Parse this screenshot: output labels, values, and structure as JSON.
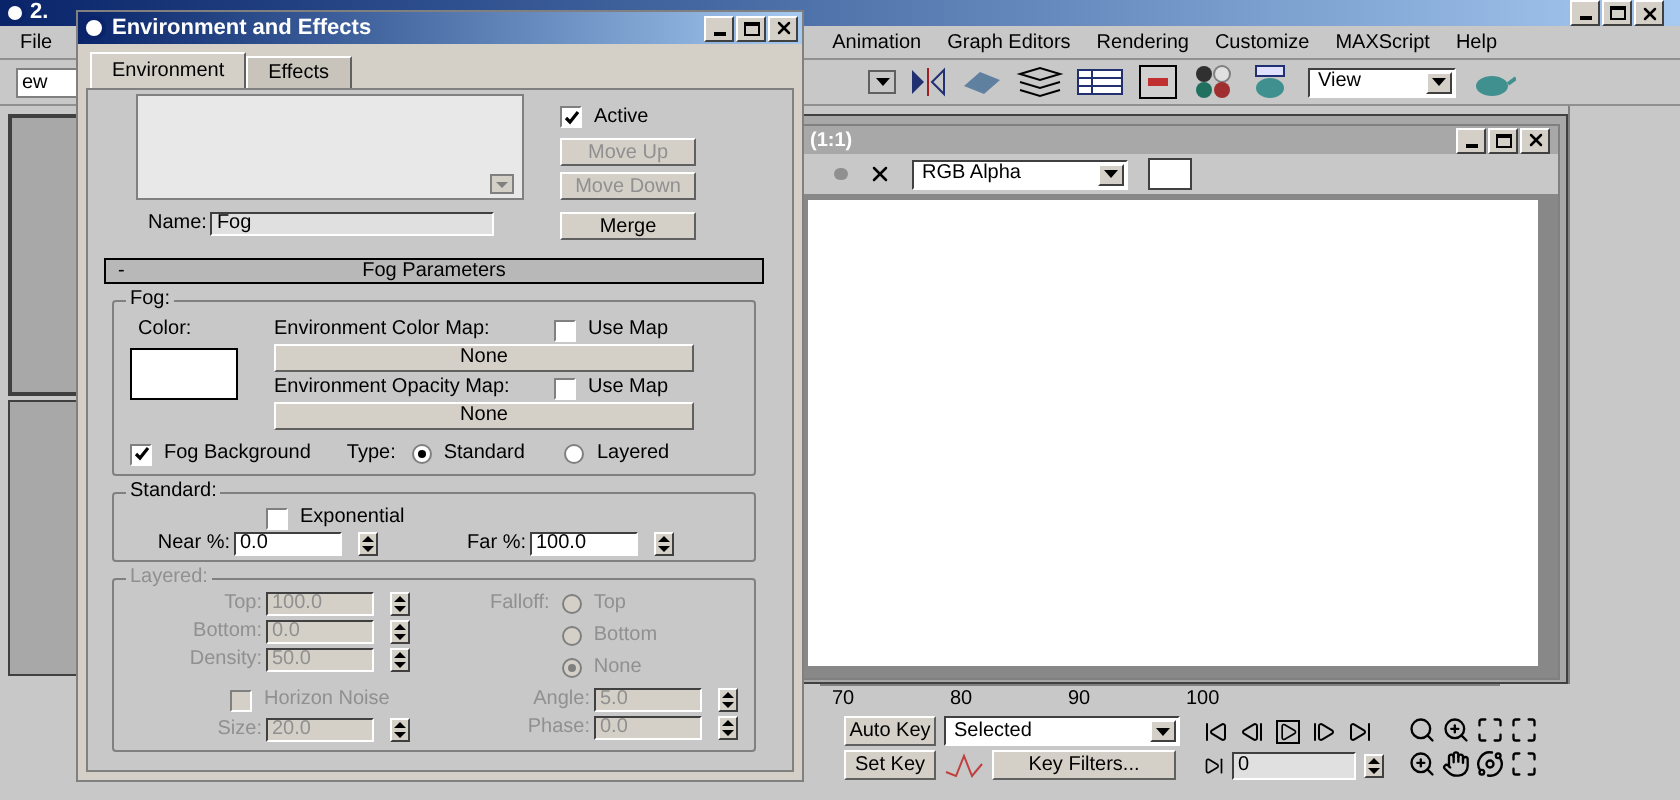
{
  "app": {
    "title": "2.",
    "menu": [
      {
        "label": "File"
      },
      {
        "label": "Animation"
      },
      {
        "label": "Graph Editors"
      },
      {
        "label": "Rendering"
      },
      {
        "label": "Customize"
      },
      {
        "label": "MAXScript"
      },
      {
        "label": "Help"
      }
    ],
    "toolbar": {
      "left_dropdown": "ew",
      "view_dropdown": "View"
    },
    "timeline": {
      "ticks": [
        "70",
        "80",
        "90",
        "100"
      ]
    },
    "anim_controls": {
      "auto_key": "Auto Key",
      "key_mode": "Selected",
      "set_key": "Set Key",
      "key_filters": "Key Filters...",
      "frame": "0"
    }
  },
  "render_window": {
    "title": "(1:1)",
    "channel": "RGB Alpha"
  },
  "dialog": {
    "title": "Environment and Effects",
    "tabs": [
      {
        "label": "Environment",
        "selected": true
      },
      {
        "label": "Effects",
        "selected": false
      }
    ],
    "active": {
      "label": "Active",
      "checked": true
    },
    "buttons": [
      {
        "label": "Move Up",
        "disabled": true
      },
      {
        "label": "Move Down",
        "disabled": true
      }
    ],
    "name": {
      "label": "Name:",
      "value": "Fog"
    },
    "merge": "Merge",
    "rollout": {
      "toggle": "-",
      "title": "Fog Parameters",
      "expanded": true
    },
    "fog": {
      "group": "Fog:",
      "color_label": "Color:",
      "maps": [
        {
          "label": "Environment Color Map:",
          "use_map": {
            "label": "Use Map",
            "checked": false
          },
          "button": "None"
        },
        {
          "label": "Environment Opacity Map:",
          "use_map": {
            "label": "Use Map",
            "checked": false
          },
          "button": "None"
        }
      ],
      "fog_background": {
        "label": "Fog Background",
        "checked": true
      },
      "type_label": "Type:",
      "types": [
        {
          "label": "Standard",
          "selected": true
        },
        {
          "label": "Layered",
          "selected": false
        }
      ]
    },
    "standard": {
      "group": "Standard:",
      "exponential": {
        "label": "Exponential",
        "checked": false
      },
      "near": {
        "label": "Near %:",
        "value": "0.0"
      },
      "far": {
        "label": "Far %:",
        "value": "100.0"
      }
    },
    "layered": {
      "group": "Layered:",
      "disabled": true,
      "fields": [
        {
          "label": "Top:",
          "value": "100.0"
        },
        {
          "label": "Bottom:",
          "value": "0.0"
        },
        {
          "label": "Density:",
          "value": "50.0"
        }
      ],
      "falloff_label": "Falloff:",
      "falloff": [
        {
          "label": "Top",
          "selected": false
        },
        {
          "label": "Bottom",
          "selected": false
        },
        {
          "label": "None",
          "selected": true
        }
      ],
      "horizon_noise": {
        "label": "Horizon Noise",
        "checked": false
      },
      "size": {
        "label": "Size:",
        "value": "20.0"
      },
      "angle": {
        "label": "Angle:",
        "value": "5.0"
      },
      "phase": {
        "label": "Phase:",
        "value": "0.0"
      }
    }
  }
}
